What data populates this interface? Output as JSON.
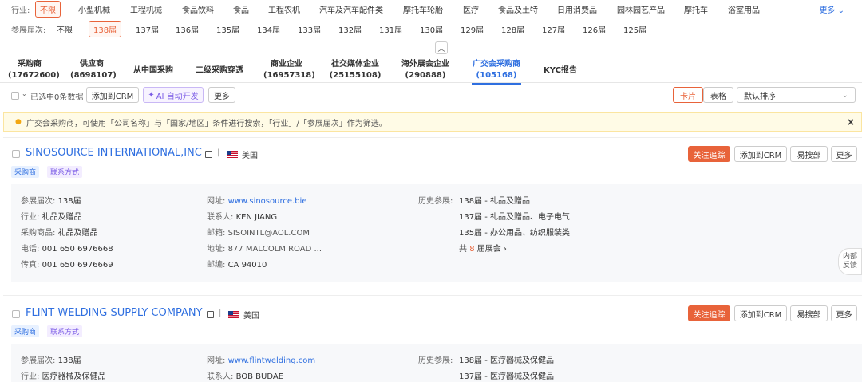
{
  "industry_filter": {
    "label": "行业:",
    "options": [
      "不限",
      "小型机械",
      "工程机械",
      "食品饮料",
      "食品",
      "工程农机",
      "汽车及汽车配件类",
      "摩托车轮胎",
      "医疗",
      "食品及土特",
      "日用消费品",
      "园林园艺产品",
      "摩托车",
      "浴室用品"
    ],
    "more": "更多 ⌄"
  },
  "session_filter": {
    "label": "参展届次:",
    "options": [
      "不限",
      "138届",
      "137届",
      "136届",
      "135届",
      "134届",
      "133届",
      "132届",
      "131届",
      "130届",
      "129届",
      "128届",
      "127届",
      "126届",
      "125届"
    ]
  },
  "tabs": [
    {
      "name": "采购商",
      "count": "(17672600)"
    },
    {
      "name": "供应商",
      "count": "(8698107)"
    },
    {
      "name": "从中国采购",
      "count": ""
    },
    {
      "name": "二级采购穿透",
      "count": ""
    },
    {
      "name": "商业企业",
      "count": "(16957318)"
    },
    {
      "name": "社交媒体企业",
      "count": "(25155108)"
    },
    {
      "name": "海外展会企业",
      "count": "(290888)"
    },
    {
      "name": "广交会采购商",
      "count": "(105168)"
    },
    {
      "name": "KYC报告",
      "count": ""
    }
  ],
  "toolbar": {
    "selected": "已选中0条数据",
    "add_crm": "添加到CRM",
    "ai": "AI 自动开发",
    "more": "更多",
    "card": "卡片",
    "table": "表格",
    "sort": "默认排序"
  },
  "notice": "广交会采购商，可使用「公司名称」与「国家/地区」条件进行搜索，「行业」/「参展届次」作为筛选。",
  "records": [
    {
      "name": "SINOSOURCE INTERNATIONAL,INC",
      "country": "美国",
      "tags": [
        "采购商",
        "联系方式"
      ],
      "actions": {
        "follow": "关注追踪",
        "crm": "添加到CRM",
        "search": "易搜部",
        "more": "更多"
      },
      "session": {
        "k": "参展届次:",
        "v": "138届"
      },
      "industry": {
        "k": "行业:",
        "v": "礼品及赠品"
      },
      "products": {
        "k": "采购商品:",
        "v": "礼品及赠品"
      },
      "phone": {
        "k": "电话:",
        "v": "001 650 6976668"
      },
      "fax": {
        "k": "传真:",
        "v": "001 650 6976669"
      },
      "website": {
        "k": "网址:",
        "v": "www.sinosource.bie"
      },
      "contact": {
        "k": "联系人:",
        "v": "KEN JIANG"
      },
      "email": {
        "k": "邮箱:",
        "v": "SISOINTL@AOL.COM"
      },
      "address": {
        "k": "地址:",
        "v": "877 MALCOLM ROAD ..."
      },
      "zip": {
        "k": "邮编:",
        "v": "CA 94010"
      },
      "history_label": "历史参展:",
      "history": [
        "138届 - 礼品及赠品",
        "137届 - 礼品及赠品、电子电气",
        "135届 - 办公用品、纺织服装类"
      ],
      "total": {
        "pre": "共",
        "num": "8",
        "post": "届展会 ›"
      }
    },
    {
      "name": "FLINT WELDING SUPPLY COMPANY",
      "country": "美国",
      "tags": [
        "采购商",
        "联系方式"
      ],
      "actions": {
        "follow": "关注追踪",
        "crm": "添加到CRM",
        "search": "易搜部",
        "more": "更多"
      },
      "session": {
        "k": "参展届次:",
        "v": "138届"
      },
      "industry": {
        "k": "行业:",
        "v": "医疗器械及保健品"
      },
      "website": {
        "k": "网址:",
        "v": "www.flintwelding.com"
      },
      "contact": {
        "k": "联系人:",
        "v": "BOB BUDAE"
      },
      "history_label": "历史参展:",
      "history": [
        "138届 - 医疗器械及保健品",
        "137届 - 医疗器械及保健品"
      ]
    }
  ],
  "feedback": [
    "内部",
    "反馈"
  ],
  "colors": {
    "accent": "#e8633a",
    "link": "#2f6fe0",
    "ai": "#7b5ce6",
    "notice_bg": "#fffbe6"
  }
}
